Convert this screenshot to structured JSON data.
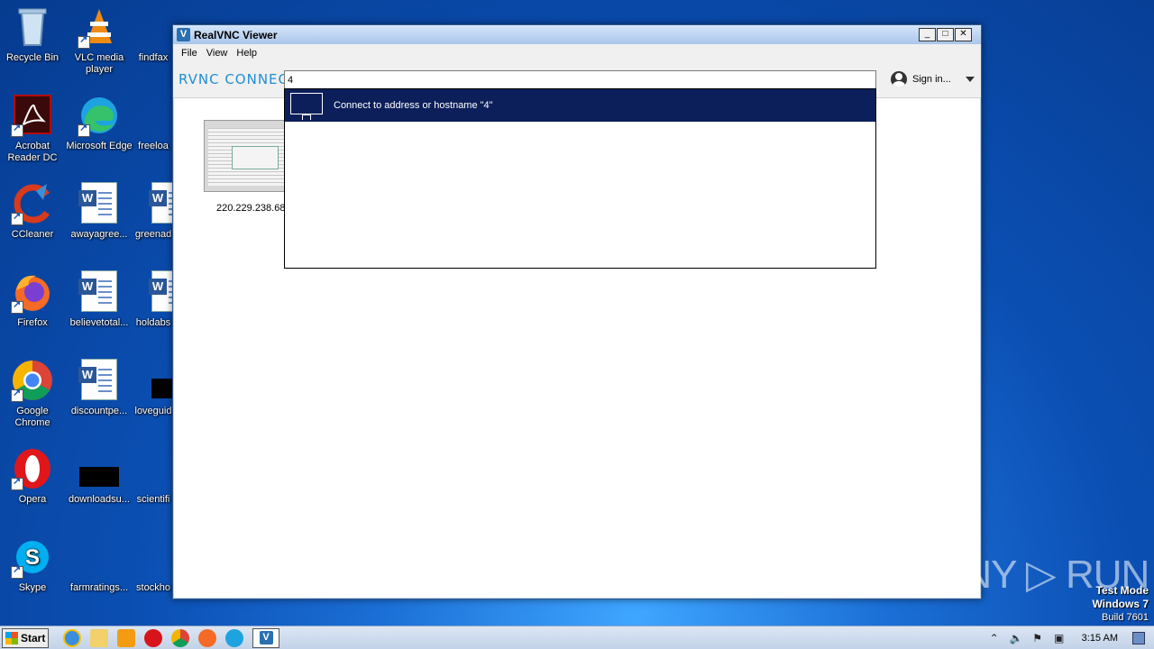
{
  "desktop": {
    "icons": [
      {
        "label": "Recycle Bin"
      },
      {
        "label": "VLC media player"
      },
      {
        "label": "findfax"
      },
      {
        "label": "Acrobat Reader DC"
      },
      {
        "label": "Microsoft Edge"
      },
      {
        "label": "freeloa"
      },
      {
        "label": "CCleaner"
      },
      {
        "label": "awayagree..."
      },
      {
        "label": "greenad"
      },
      {
        "label": "Firefox"
      },
      {
        "label": "believetotal..."
      },
      {
        "label": "holdabs"
      },
      {
        "label": "Google Chrome"
      },
      {
        "label": "discountpe..."
      },
      {
        "label": "loveguid"
      },
      {
        "label": "Opera"
      },
      {
        "label": "downloadsu..."
      },
      {
        "label": "scientifi"
      },
      {
        "label": "Skype"
      },
      {
        "label": "farmratings..."
      },
      {
        "label": "stockho"
      }
    ]
  },
  "window": {
    "title": "RealVNC Viewer",
    "controls": {
      "minimize": "_",
      "maximize": "□",
      "close": "✕"
    },
    "menu": [
      "File",
      "View",
      "Help"
    ],
    "brand": "RVNC CONNECT",
    "search": {
      "value": "4"
    },
    "signin_label": "Sign in...",
    "thumbnail_label": "220.229.238.68",
    "suggestion": "Connect to address or hostname \"4\""
  },
  "watermark": {
    "text": "ANY ▷ RUN"
  },
  "test_mode": {
    "line1": "Test Mode",
    "line2": "Windows 7",
    "line3": "Build 7601"
  },
  "taskbar": {
    "start_label": "Start",
    "clock": "3:15 AM",
    "pinned_icons": [
      "ie-icon",
      "explorer-icon",
      "media-player-icon",
      "opera-icon",
      "chrome-icon",
      "firefox-icon",
      "edge-icon",
      "realvnc-icon"
    ]
  }
}
